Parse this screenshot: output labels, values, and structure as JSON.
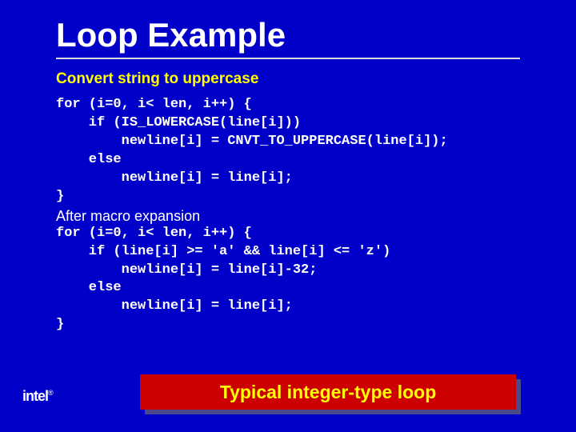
{
  "title": "Loop Example",
  "subtitle": "Convert string to uppercase",
  "code1": "for (i=0, i< len, i++) {\n    if (IS_LOWERCASE(line[i]))\n        newline[i] = CNVT_TO_UPPERCASE(line[i]);\n    else\n        newline[i] = line[i];\n}",
  "after_label": "After macro expansion",
  "code2": "for (i=0, i< len, i++) {\n    if (line[i] >= 'a' && line[i] <= 'z')\n        newline[i] = line[i]-32;\n    else\n        newline[i] = line[i];\n}",
  "banner": "Typical integer-type loop",
  "logo_text": "intel",
  "logo_reg": "®"
}
